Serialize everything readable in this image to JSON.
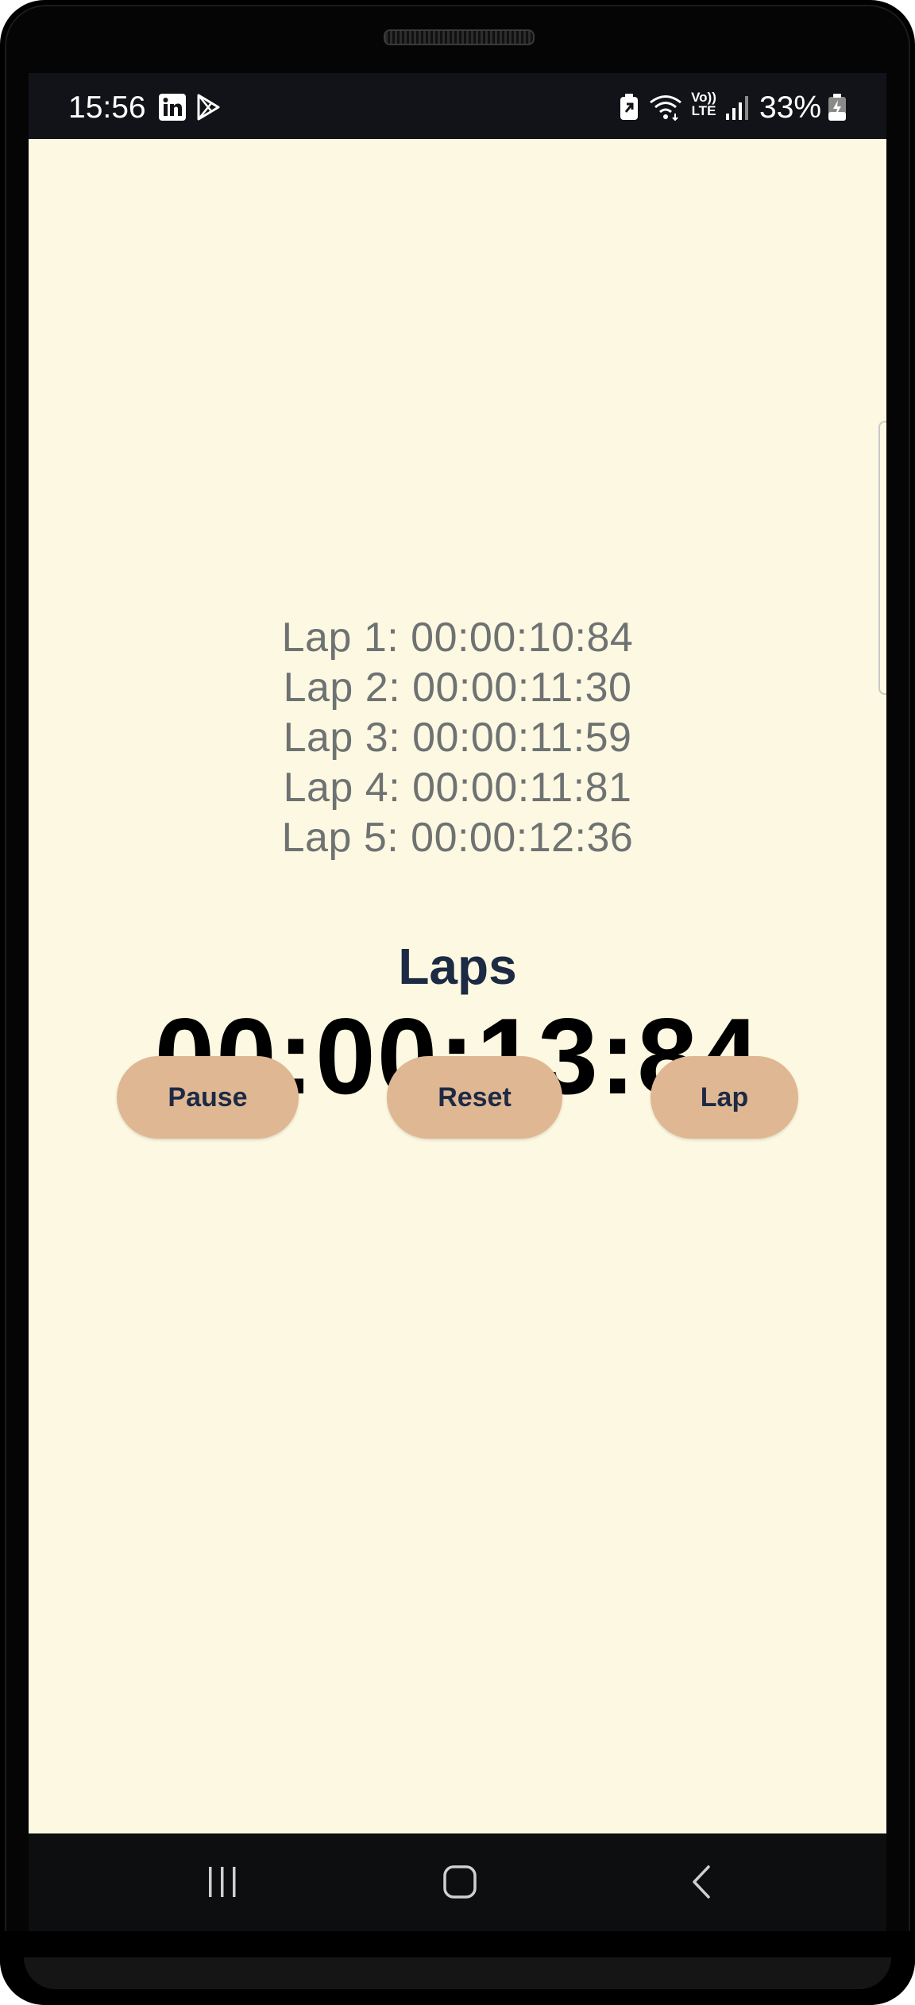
{
  "status_bar": {
    "time": "15:56",
    "left_icons": [
      "linkedin-icon",
      "play-store-icon"
    ],
    "right_icons": [
      "battery-saver-icon",
      "wifi-icon",
      "volte-icon",
      "signal-icon"
    ],
    "volte_label_top": "Vo))",
    "volte_label_bottom": "LTE",
    "battery": "33%"
  },
  "laps": {
    "title": "Laps",
    "items": [
      "Lap 1: 00:00:10:84",
      "Lap 2: 00:00:11:30",
      "Lap 3: 00:00:11:59",
      "Lap 4: 00:00:11:81",
      "Lap 5: 00:00:12:36"
    ]
  },
  "timer": {
    "display": "00:00:13:84"
  },
  "controls": {
    "pause_label": "Pause",
    "reset_label": "Reset",
    "lap_label": "Lap"
  },
  "nav_bar": {
    "icons": [
      "recents-icon",
      "home-icon",
      "back-icon"
    ]
  },
  "colors": {
    "background": "#fdf8e1",
    "button": "#dfb793",
    "button_text": "#1d2a44",
    "lap_text": "#6e7272",
    "timer_text": "#000000"
  }
}
